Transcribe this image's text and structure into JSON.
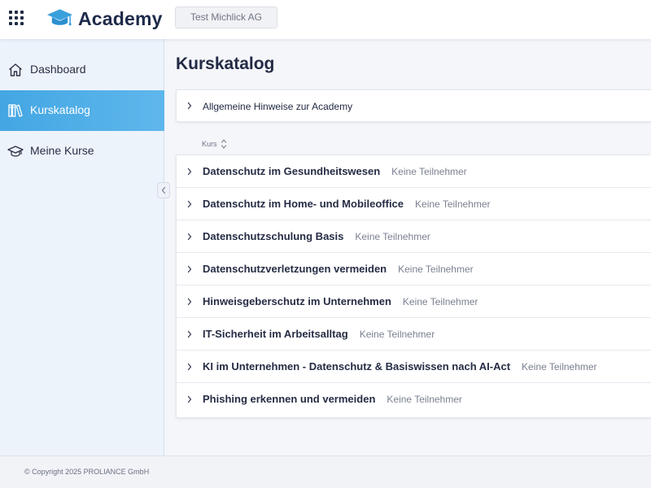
{
  "header": {
    "app_name": "Academy",
    "organization": "Test Michlick AG"
  },
  "sidebar": {
    "items": [
      {
        "label": "Dashboard",
        "icon": "home-icon",
        "active": false
      },
      {
        "label": "Kurskatalog",
        "icon": "library-icon",
        "active": true
      },
      {
        "label": "Meine Kurse",
        "icon": "graduation-cap-icon",
        "active": false
      }
    ]
  },
  "main": {
    "title": "Kurskatalog",
    "info_panel": {
      "label": "Allgemeine Hinweise zur Academy"
    },
    "table": {
      "column_header": "Kurs",
      "rows": [
        {
          "name": "Datenschutz im Gesundheitswesen",
          "status": "Keine Teilnehmer"
        },
        {
          "name": "Datenschutz im Home- und Mobileoffice",
          "status": "Keine Teilnehmer"
        },
        {
          "name": "Datenschutzschulung Basis",
          "status": "Keine Teilnehmer"
        },
        {
          "name": "Datenschutzverletzungen vermeiden",
          "status": "Keine Teilnehmer"
        },
        {
          "name": "Hinweisgeberschutz im Unternehmen",
          "status": "Keine Teilnehmer"
        },
        {
          "name": "IT-Sicherheit im Arbeitsalltag",
          "status": "Keine Teilnehmer"
        },
        {
          "name": "KI im Unternehmen - Datenschutz & Basiswissen nach AI-Act",
          "status": "Keine Teilnehmer"
        },
        {
          "name": "Phishing erkennen und vermeiden",
          "status": "Keine Teilnehmer"
        }
      ]
    }
  },
  "footer": {
    "copyright": "© Copyright 2025 PROLIANCE GmbH"
  },
  "colors": {
    "brand": "#1e2a4a",
    "logo_blue": "#3aa0dc",
    "active_nav": "#4aaae6",
    "sidebar_bg": "#edf3fb"
  }
}
